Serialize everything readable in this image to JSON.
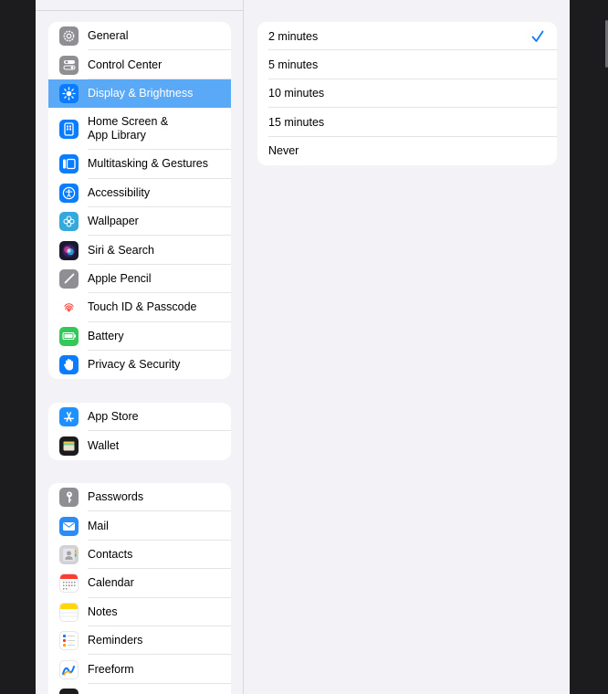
{
  "sidebar": {
    "groups": [
      {
        "items": [
          {
            "label": "General",
            "icon": "gear-icon",
            "color": "#8e8e93"
          },
          {
            "label": "Control Center",
            "icon": "switches-icon",
            "color": "#8e8e93"
          },
          {
            "label": "Display & Brightness",
            "icon": "sun-icon",
            "color": "#0a7cff",
            "selected": true
          },
          {
            "label": "Home Screen &\nApp Library",
            "icon": "home-screen-icon",
            "color": "#0a7cff"
          },
          {
            "label": "Multitasking & Gestures",
            "icon": "multitasking-icon",
            "color": "#0a7cff"
          },
          {
            "label": "Accessibility",
            "icon": "accessibility-icon",
            "color": "#0a7cff"
          },
          {
            "label": "Wallpaper",
            "icon": "flower-icon",
            "color": "#34aadc"
          },
          {
            "label": "Siri & Search",
            "icon": "siri-icon",
            "color": "#1a1a2e"
          },
          {
            "label": "Apple Pencil",
            "icon": "pencil-icon",
            "color": "#8e8e93"
          },
          {
            "label": "Touch ID & Passcode",
            "icon": "fingerprint-icon",
            "color": "#ff3b30"
          },
          {
            "label": "Battery",
            "icon": "battery-icon",
            "color": "#34c759"
          },
          {
            "label": "Privacy & Security",
            "icon": "hand-icon",
            "color": "#0a7cff"
          }
        ]
      },
      {
        "items": [
          {
            "label": "App Store",
            "icon": "app-store-icon",
            "color": "#1e90ff"
          },
          {
            "label": "Wallet",
            "icon": "wallet-icon",
            "color": "#1c1c1e"
          }
        ]
      },
      {
        "items": [
          {
            "label": "Passwords",
            "icon": "key-icon",
            "color": "#8e8e93"
          },
          {
            "label": "Mail",
            "icon": "mail-icon",
            "color": "#2a8cf7"
          },
          {
            "label": "Contacts",
            "icon": "contacts-icon",
            "color": "#c7c7cc"
          },
          {
            "label": "Calendar",
            "icon": "calendar-icon",
            "color": "#ffffff"
          },
          {
            "label": "Notes",
            "icon": "notes-icon",
            "color": "#ffd60a"
          },
          {
            "label": "Reminders",
            "icon": "reminders-icon",
            "color": "#ffffff"
          },
          {
            "label": "Freeform",
            "icon": "freeform-icon",
            "color": "#ffffff"
          },
          {
            "label": "",
            "icon": "voice-memos-icon",
            "color": "#1c1c1e"
          }
        ]
      }
    ]
  },
  "detail": {
    "options": [
      {
        "label": "2 minutes",
        "checked": true
      },
      {
        "label": "5 minutes",
        "checked": false
      },
      {
        "label": "10 minutes",
        "checked": false
      },
      {
        "label": "15 minutes",
        "checked": false
      },
      {
        "label": "Never",
        "checked": false
      }
    ],
    "accent": "#0a7cff"
  }
}
